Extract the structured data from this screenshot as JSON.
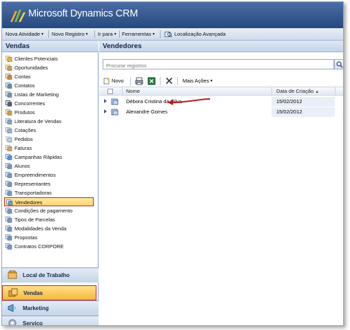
{
  "app": {
    "brand": "Microsoft Dynamics CRM"
  },
  "menubar": {
    "items": [
      {
        "label": "Nova Atividade",
        "chevron": true
      },
      {
        "label": "Novo Registro",
        "chevron": true
      },
      {
        "label": "Ir para",
        "chevron": true
      },
      {
        "label": "Ferramentas",
        "chevron": true
      },
      {
        "label": "Localização Avançada",
        "chevron": false
      }
    ]
  },
  "sidebar": {
    "title": "Vendas",
    "items": [
      {
        "label": "Clientes Potenciais",
        "icon": "leads-icon"
      },
      {
        "label": "Oportunidades",
        "icon": "opportunity-icon"
      },
      {
        "label": "Contas",
        "icon": "account-icon"
      },
      {
        "label": "Contatos",
        "icon": "contact-icon"
      },
      {
        "label": "Listas de Marketing",
        "icon": "list-icon"
      },
      {
        "label": "Concorrentes",
        "icon": "competitor-icon"
      },
      {
        "label": "Produtos",
        "icon": "product-icon"
      },
      {
        "label": "Literatura de Vendas",
        "icon": "literature-icon"
      },
      {
        "label": "Cotações",
        "icon": "quote-icon"
      },
      {
        "label": "Pedidos",
        "icon": "order-icon"
      },
      {
        "label": "Faturas",
        "icon": "invoice-icon"
      },
      {
        "label": "Campanhas Rápidas",
        "icon": "campaign-icon"
      },
      {
        "label": "Alunos",
        "icon": "entity-icon"
      },
      {
        "label": "Empreendimentos",
        "icon": "entity-icon"
      },
      {
        "label": "Representantes",
        "icon": "entity-icon"
      },
      {
        "label": "Transportadoras",
        "icon": "entity-icon"
      },
      {
        "label": "Vendedores",
        "icon": "entity-icon",
        "selected": true
      },
      {
        "label": "Condições de pagamento",
        "icon": "entity-icon"
      },
      {
        "label": "Tipos de Parcelas",
        "icon": "entity-icon"
      },
      {
        "label": "Modalidades da Venda",
        "icon": "entity-icon"
      },
      {
        "label": "Propostas",
        "icon": "entity-icon"
      },
      {
        "label": "Contratos CORPORE",
        "icon": "entity-icon"
      }
    ],
    "wunderbar": [
      {
        "label": "Local de Trabalho",
        "icon": "workplace-icon",
        "active": false
      },
      {
        "label": "Vendas",
        "icon": "sales-icon",
        "active": true
      },
      {
        "label": "Marketing",
        "icon": "marketing-icon",
        "active": false
      },
      {
        "label": "Serviço",
        "icon": "service-icon",
        "active": false
      }
    ]
  },
  "main": {
    "title": "Vendedores",
    "search_placeholder": "Procurar registros",
    "toolbar": {
      "new_label": "Novo",
      "more_actions_label": "Mais Ações"
    },
    "columns": {
      "name": "Nome",
      "created": "Data de Criação"
    },
    "rows": [
      {
        "name": "Débora Cristina da Silva",
        "created": "15/02/2012"
      },
      {
        "name": "Alexandre Gomes",
        "created": "15/02/2012"
      }
    ]
  },
  "colors": {
    "header": "#3a5d93",
    "highlight_border": "#b42a2a",
    "selected_fill": "#ffd56a",
    "annotation_arrow": "#c0161d"
  }
}
